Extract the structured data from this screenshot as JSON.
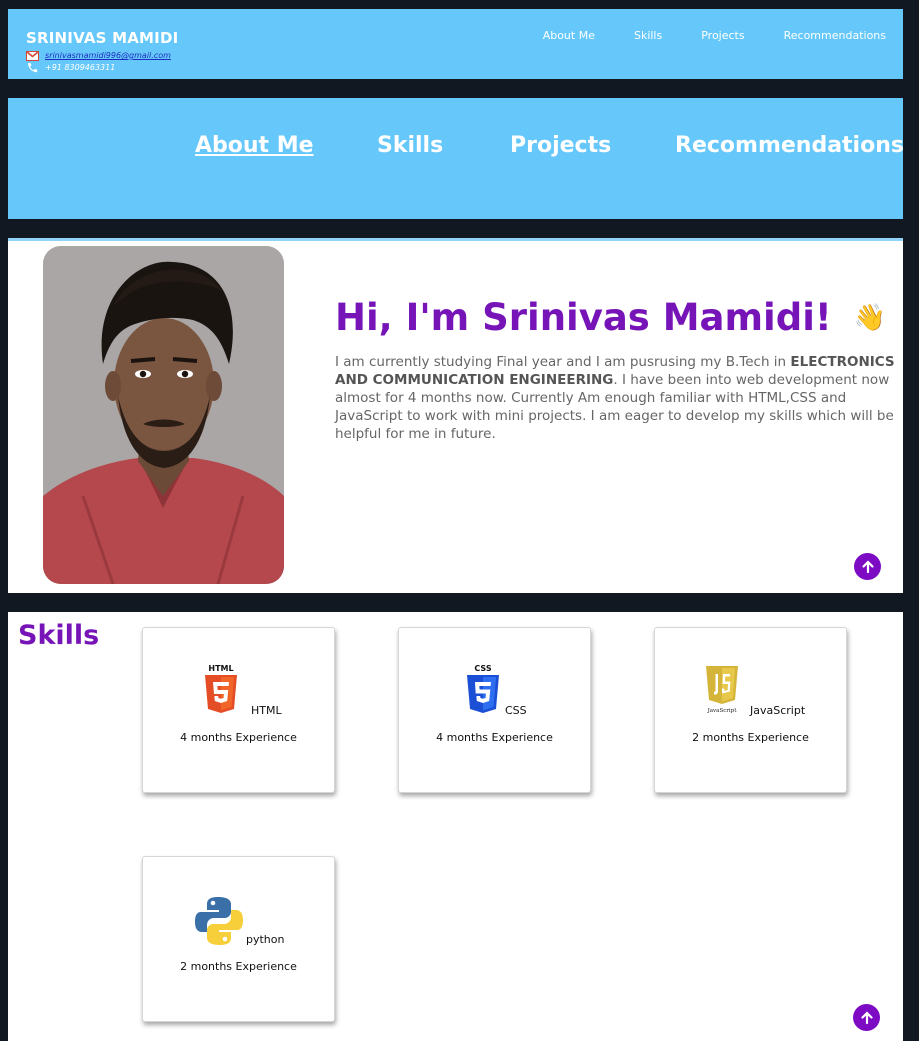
{
  "header": {
    "name": "SRINIVAS MAMIDI",
    "email": "srinivasmamidi996@gmail.com",
    "phone": "+91 8309463311",
    "nav": [
      "About Me",
      "Skills",
      "Projects",
      "Recommendations"
    ]
  },
  "main_nav": {
    "items": [
      "About Me",
      "Skills",
      "Projects",
      "Recommendations"
    ],
    "active": "About Me"
  },
  "about": {
    "greeting": "Hi, I'm Srinivas Mamidi!",
    "wave_icon": "👋",
    "text_1": "I am currently studying Final year and I am pusrusing my B.Tech in ",
    "text_bold": "ELECTRONICS AND COMMUNICATION ENGINEERING",
    "text_2": ". I have been into web development now almost for 4 months now. Currently Am enough familiar with HTML,CSS and JavaScript to work with mini projects. I am eager to develop my skills which will be helpful for me in future."
  },
  "skills": {
    "title": "Skills",
    "cards": [
      {
        "name": "HTML",
        "experience": "4 months Experience",
        "logo_text": "HTML"
      },
      {
        "name": "CSS",
        "experience": "4 months Experience",
        "logo_text": "CSS"
      },
      {
        "name": "JavaScript",
        "experience": "2 months Experience",
        "logo_text": "JavaScript"
      },
      {
        "name": "python",
        "experience": "2 months Experience"
      }
    ]
  },
  "colors": {
    "accent": "#66c8fa",
    "purple": "#7614b8",
    "background": "#111821"
  }
}
